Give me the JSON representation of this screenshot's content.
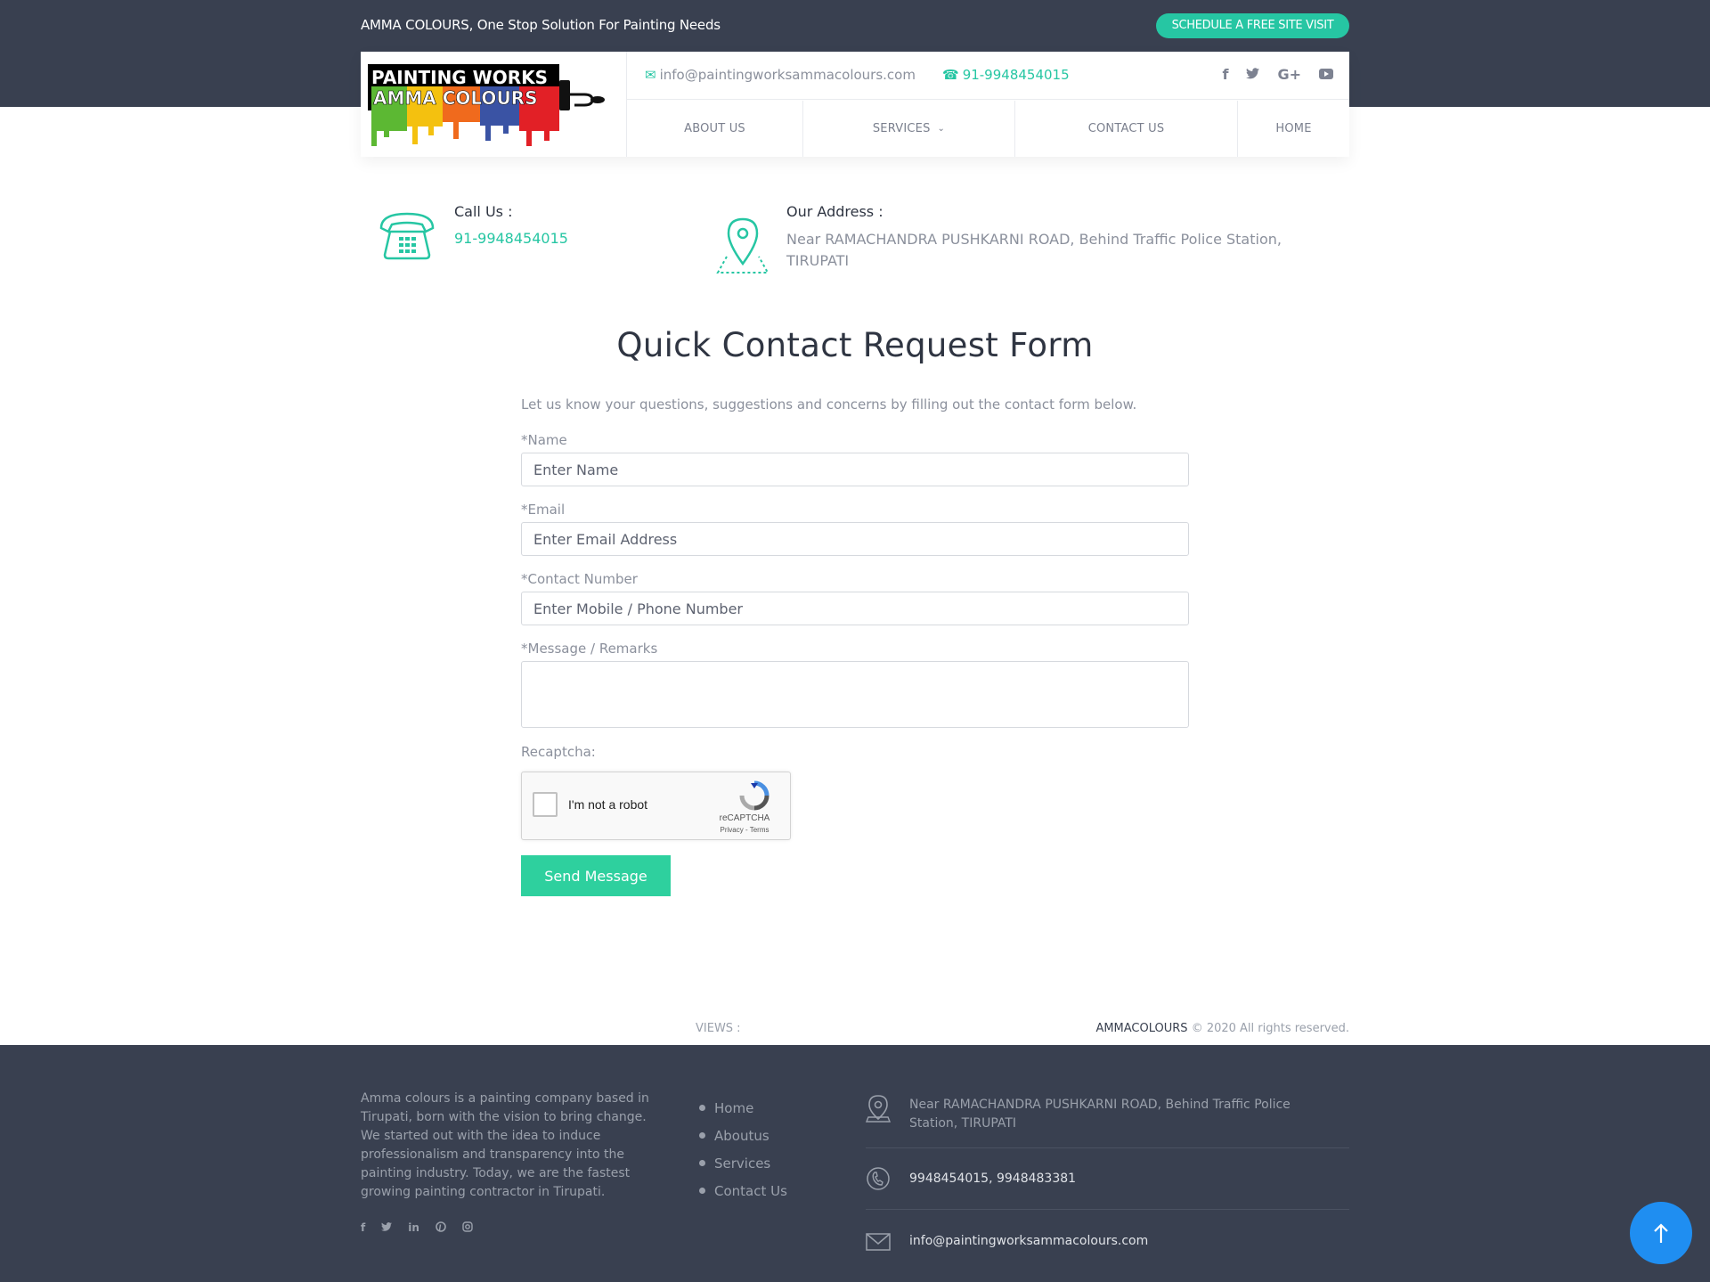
{
  "topbar": {
    "tagline": "AMMA COLOURS, One Stop Solution For Painting Needs",
    "cta_label": "SCHEDULE A FREE SITE VISIT"
  },
  "header": {
    "logo_line1": "PAINTING WORKS",
    "logo_line2": "AMMA COLOURS",
    "email": "info@paintingworksammacolours.com",
    "phone": "91-9948454015",
    "social_icons": [
      "facebook-icon",
      "twitter-icon",
      "google-plus-icon",
      "youtube-icon"
    ]
  },
  "nav": {
    "items": [
      "ABOUT US",
      "SERVICES",
      "CONTACT US",
      "HOME"
    ]
  },
  "info": {
    "call_title": "Call Us :",
    "call_value": "91-9948454015",
    "address_title": "Our Address :",
    "address_value": "Near RAMACHANDRA PUSHKARNI ROAD, Behind Traffic Police Station, TIRUPATI"
  },
  "form": {
    "title": "Quick Contact Request Form",
    "intro": "Let us know your questions, suggestions and concerns by filling out the contact form below.",
    "name_label": "*Name",
    "name_placeholder": "Enter Name",
    "email_label": "*Email",
    "email_placeholder": "Enter Email Address",
    "contact_label": "*Contact Number",
    "contact_placeholder": "Enter Mobile / Phone Number",
    "message_label": "*Message / Remarks",
    "recaptcha_label": "Recaptcha:",
    "recaptcha_text": "I'm not a robot",
    "recaptcha_brand": "reCAPTCHA",
    "recaptcha_links": "Privacy - Terms",
    "submit_label": "Send Message"
  },
  "bottombar": {
    "views_label": "VIEWS :",
    "copyright_brand": "AMMACOLOURS",
    "copyright_text": " © 2020 All rights reserved."
  },
  "footer": {
    "about": "Amma colours is a painting company based in Tirupati, born with the vision to bring change. We started out with the idea to induce professionalism and transparency into the painting industry. Today, we are the fastest growing painting contractor in Tirupati.",
    "social_icons": [
      "facebook-icon",
      "twitter-icon",
      "linkedin-icon",
      "pinterest-icon",
      "instagram-icon"
    ],
    "links": [
      "Home",
      "Aboutus",
      "Services",
      "Contact Us"
    ],
    "address": "Near RAMACHANDRA PUSHKARNI ROAD, Behind Traffic Police Station, TIRUPATI",
    "phones": "9948454015, 9948483381",
    "email": "info@paintingworksammacolours.com"
  },
  "colors": {
    "accent": "#26c6a3",
    "dark": "#394050",
    "button": "#2ed09e",
    "scroll_top": "#1f8ef1"
  }
}
